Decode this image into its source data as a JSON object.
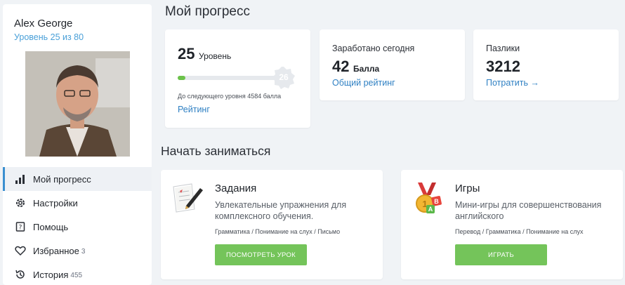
{
  "profile": {
    "name": "Alex George",
    "level_text": "Уровень 25 из 80"
  },
  "nav": {
    "items": [
      {
        "label": "Мой прогресс",
        "icon": "bar-chart-icon",
        "active": true
      },
      {
        "label": "Настройки",
        "icon": "gear-icon"
      },
      {
        "label": "Помощь",
        "icon": "help-icon"
      },
      {
        "label": "Избранное",
        "icon": "heart-icon",
        "count": "3"
      },
      {
        "label": "История",
        "icon": "history-icon",
        "count": "455"
      }
    ]
  },
  "main": {
    "title": "Мой прогресс",
    "level_card": {
      "level": "25",
      "level_word": "Уровень",
      "next_level": "26",
      "progress_fraction": 0.07,
      "next_text": "До следующего уровня 4584 балла",
      "link": "Рейтинг"
    },
    "earned_card": {
      "label": "Заработано сегодня",
      "value": "42",
      "unit": "Балла",
      "link": "Общий рейтинг"
    },
    "puzzles_card": {
      "label": "Пазлики",
      "value": "3212",
      "link": "Потратить →"
    },
    "section_title": "Начать заниматься",
    "tasks_card": {
      "title": "Задания",
      "description": "Увлекательные упражнения для комплексного обучения.",
      "tags": "Грамматика / Понимание на слух / Письмо",
      "button": "ПОСМОТРЕТЬ УРОК",
      "icon": "paper-pen-icon"
    },
    "games_card": {
      "title": "Игры",
      "description": "Мини-игры для совершенствования английского",
      "tags": "Перевод / Грамматика / Понимание на слух",
      "button": "ИГРАТЬ",
      "icon": "medal-icon"
    }
  },
  "colors": {
    "accent_blue": "#2f80c3",
    "green": "#74c45a",
    "progress_green": "#6cc24a",
    "background": "#f0f3f6"
  }
}
